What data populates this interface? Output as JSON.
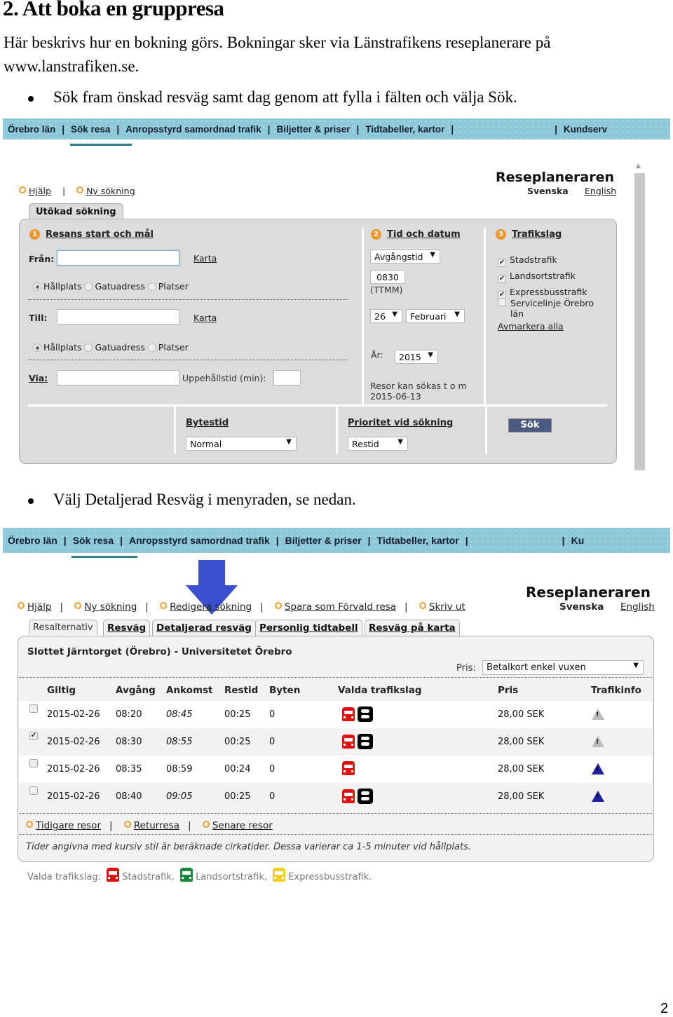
{
  "doc": {
    "heading": "2. Att boka en gruppresa",
    "intro_line1": "Här beskrivs hur en bokning görs. Bokningar sker via Länstrafikens reseplanerare på",
    "intro_line2": "www.lanstrafiken.se.",
    "bullet1": "Sök fram önskad resväg samt dag genom att fylla i fälten och välja Sök.",
    "bullet2": "Välj Detaljerad Resväg i menyraden, se nedan.",
    "page_number": "2"
  },
  "navbar1": {
    "items": [
      "Örebro län",
      "Sök resa",
      "Anropsstyrd samordnad trafik",
      "Biljetter & priser",
      "Tidtabeller, kartor",
      "Kundserv"
    ]
  },
  "navbar2": {
    "items": [
      "Örebro län",
      "Sök resa",
      "Anropsstyrd samordnad trafik",
      "Biljetter & priser",
      "Tidtabeller, kartor",
      "Ku"
    ]
  },
  "search": {
    "links": [
      "Hjälp",
      "Ny sökning"
    ],
    "app_title": "Reseplaneraren",
    "lang_current": "Svenska",
    "lang_other": "English",
    "tab": "Utökad sökning",
    "section1": {
      "num": "1",
      "title": "Resans start och mål"
    },
    "from_label": "Från:",
    "to_label": "Till:",
    "via_label": "Via:",
    "map_link": "Karta",
    "radio_options": [
      "Hållplats",
      "Gatuadress",
      "Platser"
    ],
    "stay_label": "Uppehållstid (min):",
    "section2": {
      "num": "2",
      "title": "Tid och datum"
    },
    "time_type": "Avgångstid",
    "time_value": "0830",
    "time_format": "(TTMM)",
    "day": "26",
    "month": "Februari",
    "year_label": "År:",
    "year": "2015",
    "limit_text1": "Resor kan sökas t o m",
    "limit_text2": "2015-06-13",
    "section3": {
      "num": "3",
      "title": "Trafikslag"
    },
    "modes": [
      {
        "label": "Stadstrafik",
        "checked": true
      },
      {
        "label": "Landsortstrafik",
        "checked": true
      },
      {
        "label": "Expressbusstrafik",
        "checked": true
      },
      {
        "label": "Servicelinje Örebro län",
        "checked": false
      }
    ],
    "modes_line4a": "Servicelinje Örebro",
    "modes_line4b": "län",
    "unselect_all": "Avmarkera alla",
    "transfer_title": "Bytestid",
    "transfer_value": "Normal",
    "priority_title": "Prioritet vid sökning",
    "priority_value": "Restid",
    "search_button": "Sök"
  },
  "results": {
    "links": [
      "Hjälp",
      "Ny sökning",
      "Redigera sökning",
      "Spara som Förvald resa",
      "Skriv ut"
    ],
    "app_title": "Reseplaneraren",
    "lang_current": "Svenska",
    "lang_other": "English",
    "tabs": [
      "Resalternativ",
      "Resväg",
      "Detaljerad resväg",
      "Personlig tidtabell",
      "Resväg på karta"
    ],
    "route": "Slottet Järntorget (Örebro) - Universitetet Örebro",
    "price_label": "Pris:",
    "price_type": "Betalkort enkel vuxen",
    "columns": [
      "Giltig",
      "Avgång",
      "Ankomst",
      "Restid",
      "Byten",
      "Valda trafikslag",
      "Pris",
      "Trafikinfo"
    ],
    "rows": [
      {
        "checked": false,
        "date": "2015-02-26",
        "dep": "08:20",
        "arr": "08:45",
        "arr_approx": true,
        "dur": "00:25",
        "changes": "0",
        "modes": [
          "city-bus",
          "walk"
        ],
        "price": "28,00 SEK",
        "info": "warning-grey"
      },
      {
        "checked": true,
        "date": "2015-02-26",
        "dep": "08:30",
        "arr": "08:55",
        "arr_approx": true,
        "dur": "00:25",
        "changes": "0",
        "modes": [
          "city-bus",
          "walk"
        ],
        "price": "28,00 SEK",
        "info": "warning-grey"
      },
      {
        "checked": false,
        "date": "2015-02-26",
        "dep": "08:35",
        "arr": "08:59",
        "arr_approx": false,
        "dur": "00:24",
        "changes": "0",
        "modes": [
          "city-bus"
        ],
        "price": "28,00 SEK",
        "info": "warning-blue"
      },
      {
        "checked": false,
        "date": "2015-02-26",
        "dep": "08:40",
        "arr": "09:05",
        "arr_approx": true,
        "dur": "00:25",
        "changes": "0",
        "modes": [
          "city-bus",
          "walk"
        ],
        "price": "28,00 SEK",
        "info": "warning-blue"
      }
    ],
    "footer_links": [
      "Tidigare resor",
      "Returresa",
      "Senare resor"
    ],
    "note": "Tider angivna med kursiv stil är beräknade cirkatider. Dessa varierar ca 1-5 minuter vid hållplats.",
    "legend_label": "Valda trafikslag:",
    "legend": [
      {
        "label": "Stadstrafik,",
        "color": "#e01010"
      },
      {
        "label": "Landsortstrafik,",
        "color": "#1a8a3a"
      },
      {
        "label": "Expressbusstrafik.",
        "color": "#f0d020"
      }
    ],
    "arrow_color": "#3a4fd0"
  }
}
